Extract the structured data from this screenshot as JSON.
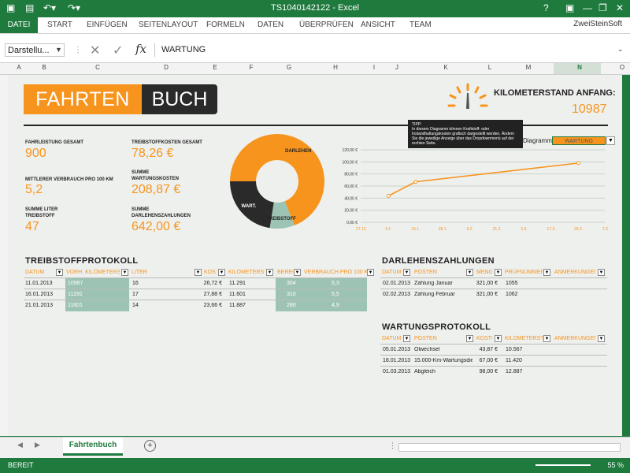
{
  "window": {
    "title": "TS1040142122 - Excel",
    "controls": [
      "?",
      "—",
      "❐",
      "✕"
    ]
  },
  "ribbon": {
    "tabs": [
      "DATEI",
      "START",
      "EINFÜGEN",
      "SEITENLAYOUT",
      "FORMELN",
      "DATEN",
      "ÜBERPRÜFEN",
      "ANSICHT",
      "TEAM"
    ],
    "account": "ZweiSteinSoft"
  },
  "formula_bar": {
    "name_box": "Darstellu...",
    "fx": "fx",
    "value": "WARTUNG"
  },
  "columns": [
    "A",
    "B",
    "C",
    "D",
    "E",
    "F",
    "G",
    "H",
    "I",
    "J",
    "K",
    "L",
    "M",
    "N",
    "O"
  ],
  "selected_column": "N",
  "logo": {
    "left": "FAHRTEN",
    "right": "BUCH"
  },
  "km_start": {
    "label": "KILOMETERSTAND ANFANG:",
    "value": "10987"
  },
  "stats": [
    {
      "label": "FAHRLEISTUNG GESAMT",
      "value": "900"
    },
    {
      "label": "MITTLERER VERBRAUCH PRO 100 KM",
      "value": "5,2"
    },
    {
      "label": "SUMME LITER TREIBSTOFF",
      "value": "47"
    },
    {
      "label": "TREIBSTOFFKOSTEN GESAMT",
      "value": "78,26 €"
    },
    {
      "label": "SUMME WARTUNGSKOSTEN",
      "value": "208,87 €"
    },
    {
      "label": "SUMME DARLEHENSZAHLUNGEN",
      "value": "642,00 €"
    }
  ],
  "tooltip": {
    "title": "TIPP:",
    "text": "In diesem Diagramm können Kraftstoff- oder Instandhaltungskosten grafisch dargestellt werden. Ändern Sie die jeweilige Anzeige über das Dropdownmenü auf der rechten Seite."
  },
  "diagram_select": {
    "label": "Diagramm:",
    "value": "WARTUNG"
  },
  "chart_data": [
    {
      "type": "pie",
      "categories": [
        "DARLEHEN",
        "TREIBSTOFF",
        "WART."
      ],
      "values": [
        642.0,
        78.26,
        208.87
      ],
      "colors": [
        "#f7941d",
        "#9dc3b4",
        "#2a2a2a"
      ],
      "hole": true
    },
    {
      "type": "line",
      "categories": [
        "27.12.",
        "4.1.",
        "16.1.",
        "28.1.",
        "9.2.",
        "21.2.",
        "5.3.",
        "17.3.",
        "29.3.",
        "7.3."
      ],
      "ytick_labels": [
        "0,00 €",
        "20,00 €",
        "40,00 €",
        "60,00 €",
        "80,00 €",
        "100,00 €",
        "120,00 €"
      ],
      "ylim": [
        0,
        120
      ],
      "points": [
        {
          "x": 1,
          "y": 43.87
        },
        {
          "x": 2,
          "y": 67.0
        },
        {
          "x": 8,
          "y": 98.0
        }
      ],
      "color": "#f7941d"
    }
  ],
  "treibstoff": {
    "title": "TREIBSTOFFPROTOKOLL",
    "headers": [
      "DATUM",
      "VORH. KILOMETERSTAND",
      "LITER",
      "KOSTEN",
      "KILOMETERSTAND",
      "BERECHNET",
      "VERBRAUCH PRO 100 KM"
    ],
    "rows": [
      [
        "11.01.2013",
        "10987",
        "16",
        "26,72 €",
        "11.291",
        "304",
        "5,3"
      ],
      [
        "16.01.2013",
        "11291",
        "17",
        "27,88 €",
        "11.601",
        "310",
        "5,5"
      ],
      [
        "21.01.2013",
        "11601",
        "14",
        "23,66 €",
        "11.887",
        "286",
        "4,9"
      ]
    ]
  },
  "darlehen": {
    "title": "DARLEHENSZAHLUNGEN",
    "headers": [
      "DATUM",
      "POSTEN",
      "MENGE",
      "PRÜFNUMMER",
      "ANMERKUNGEN"
    ],
    "rows": [
      [
        "02.01.2013",
        "Zahlung Januar",
        "321,00 €",
        "1055",
        ""
      ],
      [
        "02.02.2013",
        "Zahlung Februar",
        "321,00 €",
        "1062",
        ""
      ]
    ]
  },
  "wartung": {
    "title": "WARTUNGSPROTOKOLL",
    "headers": [
      "DATUM",
      "POSTEN",
      "KOSTEN",
      "KILOMETERSTAND",
      "ANMERKUNGEN"
    ],
    "rows": [
      [
        "05.01.2013",
        "Ölwechsel",
        "43,87 €",
        "10.567",
        ""
      ],
      [
        "18.01.2013",
        "15.000-Km-Wartungsdienst",
        "67,00 €",
        "11.420",
        ""
      ],
      [
        "01.03.2013",
        "Abgleich",
        "98,00 €",
        "12.887",
        ""
      ]
    ]
  },
  "sheet_tab": "Fahrtenbuch",
  "add_sheet": "⊕",
  "status": {
    "left": "BEREIT",
    "zoom": "55 %"
  }
}
